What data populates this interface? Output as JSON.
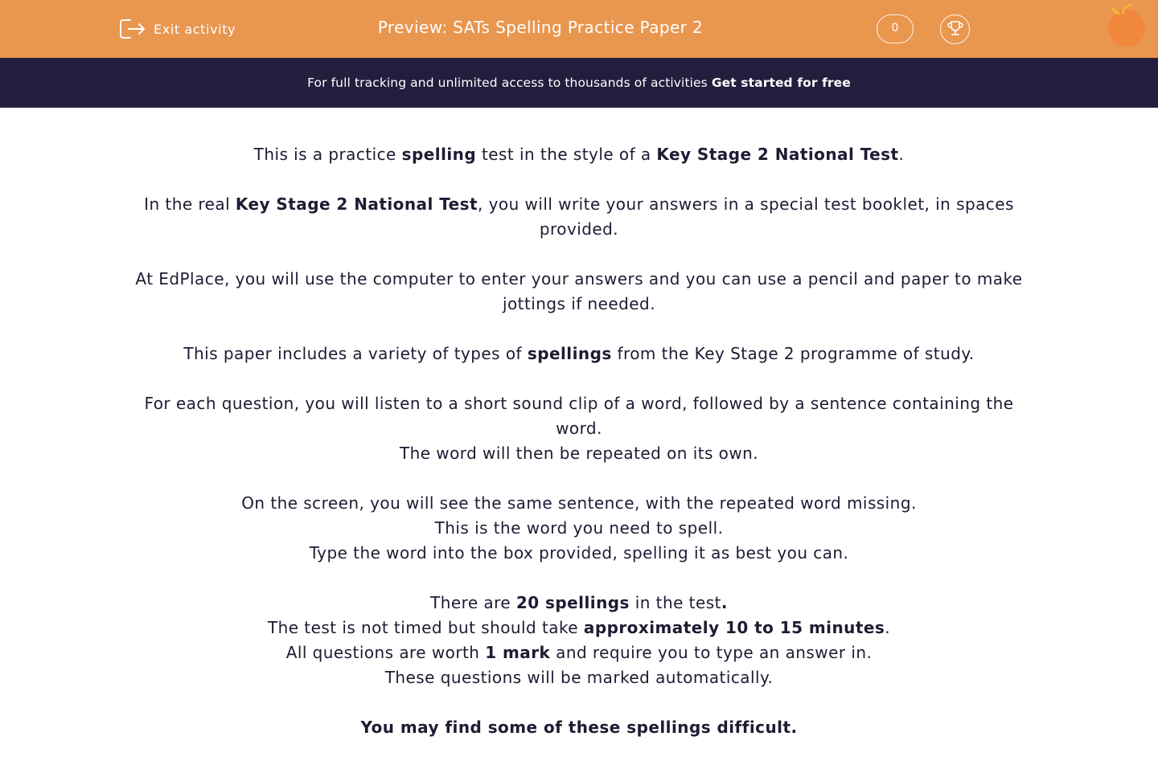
{
  "header": {
    "exit_label": "Exit activity",
    "title": "Preview: SATs Spelling Practice Paper 2",
    "score": "0",
    "background": "#e9964f"
  },
  "banner": {
    "text": "For full tracking and unlimited access to thousands of activities",
    "cta": "Get started for free",
    "background": "#241d3d"
  },
  "content": {
    "p1": {
      "a": "This is a practice ",
      "b1": "spelling",
      "c": " test in the style of a ",
      "b2": "Key Stage 2 National Test",
      "d": "."
    },
    "p2": {
      "a": "In the real ",
      "b1": "Key Stage 2 National Test",
      "c": ", you will write your answers in a special test booklet, in spaces provided."
    },
    "p3": {
      "a": "At EdPlace, you will use the computer to enter your answers and you can use a pencil and paper to make jottings if needed."
    },
    "p4": {
      "a": "This paper includes a variety of types of ",
      "b1": "spellings",
      "c": " from the Key Stage 2 programme of study."
    },
    "p5": {
      "line1": "For each question, you will listen to a short sound clip of a word, followed by a sentence containing the word.",
      "line2": "The word will then be repeated on its own."
    },
    "p6": {
      "line1": "On the screen, you will see the same sentence, with the repeated word missing.",
      "line2": "This is the word you need to spell.",
      "line3": "Type the word into the box provided, spelling it as best you can."
    },
    "p7": {
      "l1a": "There are ",
      "l1b": "20 spellings",
      "l1c": " in the test",
      "l1d": ".",
      "l2a": "The test is not timed but should take ",
      "l2b": "approximately 10 to 15 minutes",
      "l2c": ".",
      "l3a": "All questions are worth ",
      "l3b": "1 mark",
      "l3c": " and require you to type an answer in.",
      "l4": "These questions will be marked automatically."
    },
    "p8": {
      "a": "You may find some of these spellings difficult."
    }
  },
  "icons": {
    "exit": "exit-icon",
    "trophy": "trophy-icon",
    "logo": "edplace-logo"
  }
}
